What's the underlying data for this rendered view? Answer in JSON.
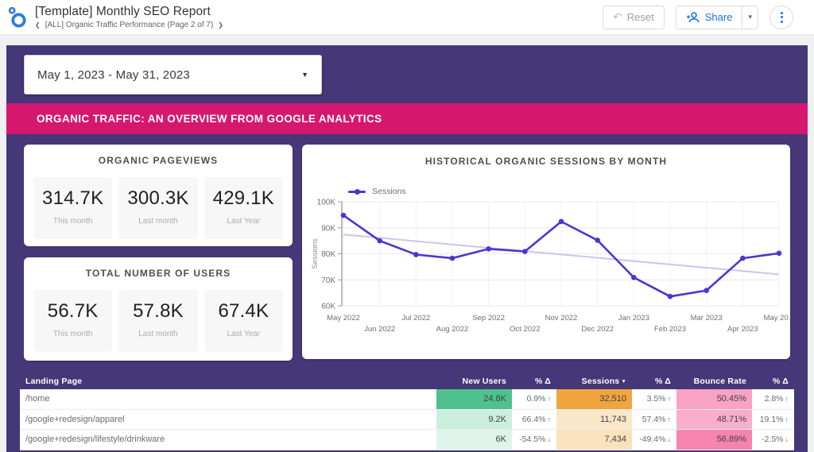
{
  "topbar": {
    "title": "[Template] Monthly SEO Report",
    "breadcrumb": "[ALL] Organic Traffic Performance (Page 2 of 7)",
    "reset_label": "Reset",
    "share_label": "Share"
  },
  "date_range": "May 1, 2023 - May 31, 2023",
  "banner": "ORGANIC TRAFFIC: AN OVERVIEW FROM GOOGLE ANALYTICS",
  "scorecards": [
    {
      "title": "ORGANIC PAGEVIEWS",
      "metrics": [
        {
          "value": "314.7K",
          "label": "This month"
        },
        {
          "value": "300.3K",
          "label": "Last month"
        },
        {
          "value": "429.1K",
          "label": "Last Year"
        }
      ]
    },
    {
      "title": "TOTAL NUMBER OF USERS",
      "metrics": [
        {
          "value": "56.7K",
          "label": "This month"
        },
        {
          "value": "57.8K",
          "label": "Last month"
        },
        {
          "value": "67.4K",
          "label": "Last Year"
        }
      ]
    }
  ],
  "chart_data": {
    "type": "line",
    "title": "HISTORICAL ORGANIC SESSIONS BY MONTH",
    "ylabel": "Sessions",
    "categories": [
      "May 2022",
      "Jun 2022",
      "Jul 2022",
      "Aug 2022",
      "Sep 2022",
      "Oct 2022",
      "Nov 2022",
      "Dec 2022",
      "Jan 2023",
      "Feb 2023",
      "Mar 2023",
      "Apr 2023",
      "May 20..."
    ],
    "series": [
      {
        "name": "Sessions",
        "color": "#5134cd",
        "values": [
          94800,
          85000,
          79700,
          78300,
          81900,
          80900,
          92400,
          85200,
          70900,
          63600,
          65900,
          78300,
          80200
        ]
      }
    ],
    "trendline": {
      "start": 87400,
      "end": 72100,
      "color": "#cbc5f1"
    },
    "ylim": [
      60000,
      100000
    ],
    "yticks": [
      "60K",
      "70K",
      "80K",
      "90K",
      "100K"
    ],
    "grid": true,
    "legend_position": "top-left"
  },
  "table": {
    "columns": [
      "Landing Page",
      "New Users",
      "% Δ",
      "Sessions",
      "% Δ",
      "Bounce Rate",
      "% Δ"
    ],
    "sorted_column": "Sessions",
    "up_color": "#10a878",
    "down_color": "#e4504f",
    "rows": [
      {
        "page": "/home",
        "new_users": "24.8K",
        "new_users_bg": "#4ec18e",
        "d1": "0.9%",
        "d1_dir": "up",
        "sessions": "32,510",
        "sessions_bg": "#f0a63e",
        "d2": "3.5%",
        "d2_dir": "up",
        "bounce": "50.45%",
        "bounce_bg": "#f8a3c4",
        "d3": "2.8%",
        "d3_dir": "up"
      },
      {
        "page": "/google+redesign/apparel",
        "new_users": "9.2K",
        "new_users_bg": "#cceede",
        "d1": "66.4%",
        "d1_dir": "up",
        "sessions": "11,743",
        "sessions_bg": "#fae7ca",
        "d2": "57.4%",
        "d2_dir": "up",
        "bounce": "48.71%",
        "bounce_bg": "#f9aecb",
        "d3": "19.1%",
        "d3_dir": "up"
      },
      {
        "page": "/google+redesign/lifestyle/drinkware",
        "new_users": "6K",
        "new_users_bg": "#def4ea",
        "d1": "-54.5%",
        "d1_dir": "down",
        "sessions": "7,434",
        "sessions_bg": "#f9e2bd",
        "d2": "-49.4%",
        "d2_dir": "down",
        "bounce": "56.89%",
        "bounce_bg": "#f784ae",
        "d3": "-2.5%",
        "d3_dir": "down"
      }
    ]
  },
  "colors": {
    "canvas": "#463778",
    "banner": "#d6176f",
    "accent_blue": "#1a73e8",
    "line": "#5134cd",
    "trend": "#cbc5f1"
  }
}
